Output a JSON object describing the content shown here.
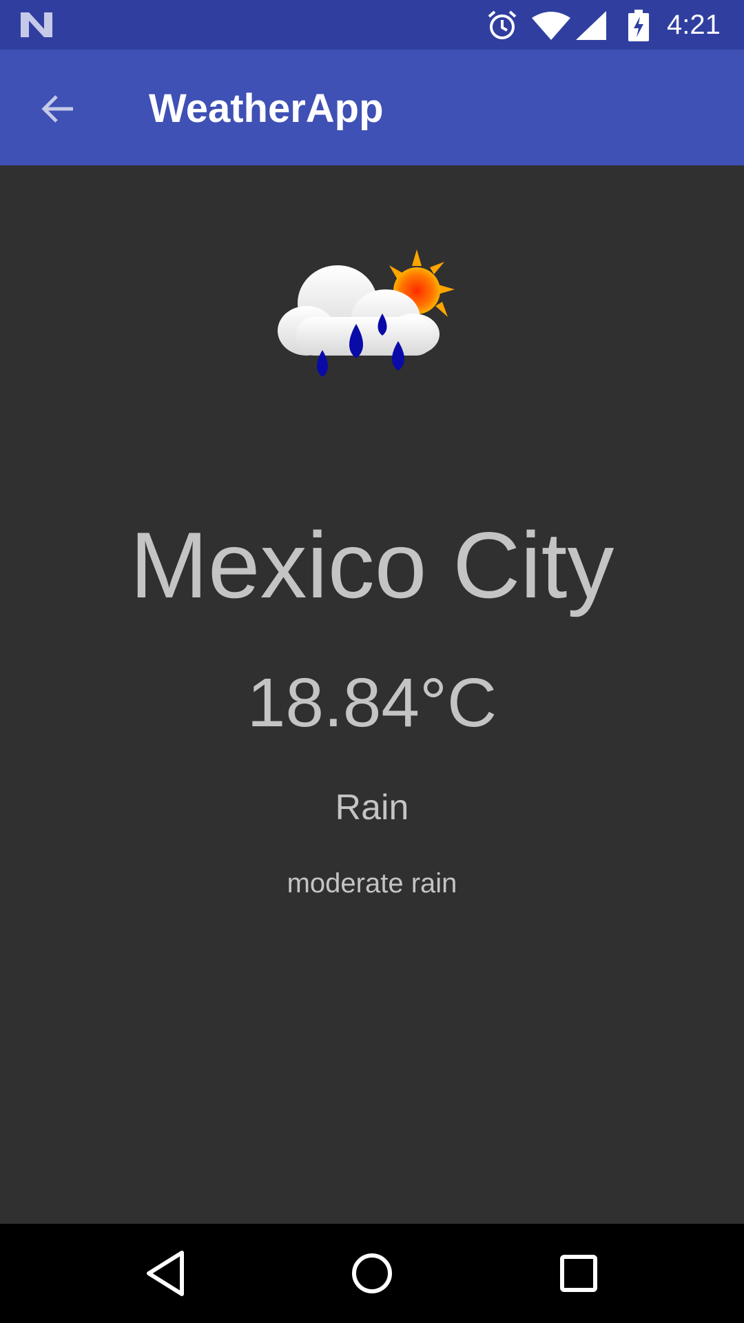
{
  "status_bar": {
    "time": "4:21",
    "icons": [
      "n-logo-icon",
      "alarm-icon",
      "wifi-icon",
      "signal-icon",
      "battery-charging-icon"
    ]
  },
  "app_bar": {
    "title": "WeatherApp",
    "back_icon": "arrow-back-icon"
  },
  "weather": {
    "icon": "cloud-rain-sun-icon",
    "city": "Mexico City",
    "temperature": "18.84°C",
    "main": "Rain",
    "description": "moderate rain"
  },
  "nav_bar": {
    "icons": [
      "nav-back-icon",
      "nav-home-icon",
      "nav-recents-icon"
    ]
  },
  "colors": {
    "status_bar": "#303F9F",
    "app_bar": "#3F51B5",
    "background": "#303030",
    "text": "#c4c4c4",
    "nav_bar": "#000000"
  }
}
